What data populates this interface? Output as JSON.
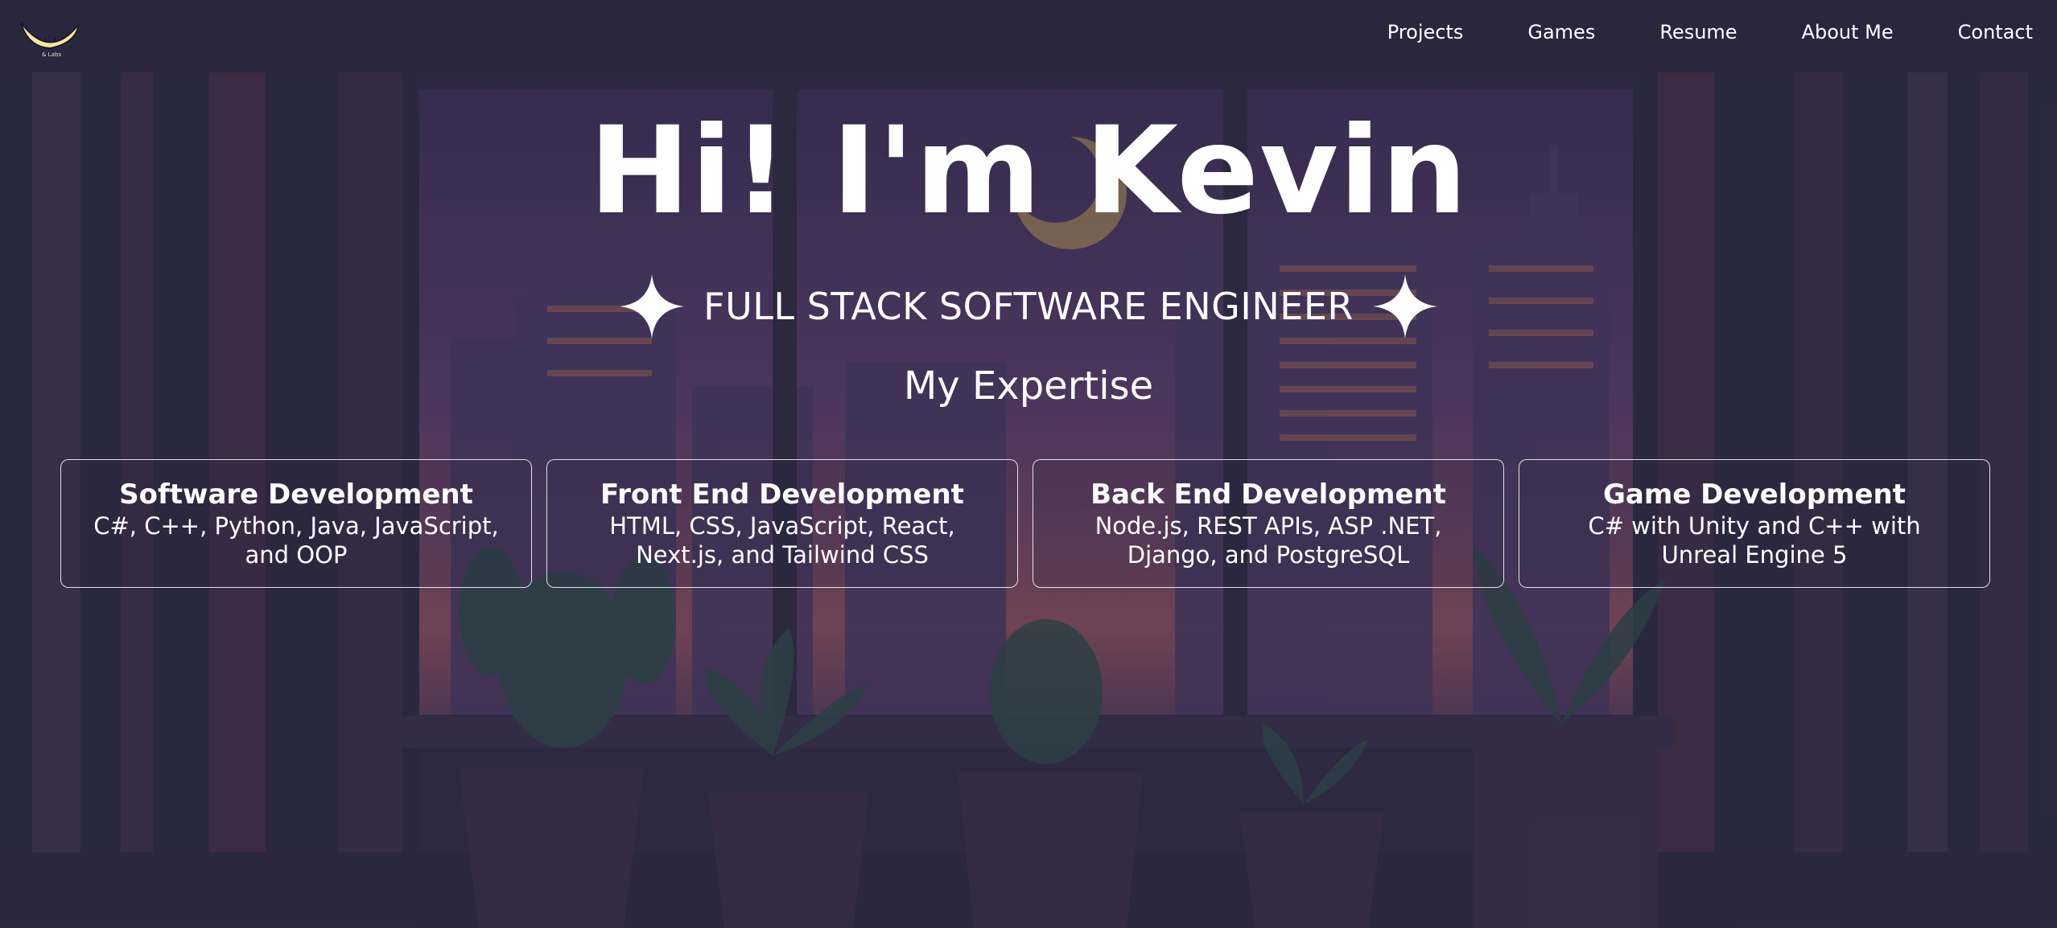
{
  "logo": {
    "text": "& Labs",
    "icon": "banana-logo-icon",
    "color": "#f6e89a"
  },
  "nav": {
    "items": [
      {
        "label": "Projects"
      },
      {
        "label": "Games"
      },
      {
        "label": "Resume"
      },
      {
        "label": "About Me"
      },
      {
        "label": "Contact"
      }
    ]
  },
  "hero": {
    "title": "Hi! I'm Kevin",
    "subtitle": "FULL STACK SOFTWARE ENGINEER",
    "sparkle_icon": "four-point-star-icon"
  },
  "expertise": {
    "heading": "My Expertise",
    "cards": [
      {
        "title": "Software Development",
        "body": "C#, C++, Python, Java, JavaScript, and OOP"
      },
      {
        "title": "Front End Development",
        "body": "HTML, CSS, JavaScript, React, Next.js, and Tailwind CSS"
      },
      {
        "title": "Back End Development",
        "body": "Node.js, REST APIs, ASP .NET, Django, and PostgreSQL"
      },
      {
        "title": "Game Development",
        "body": "C# with Unity and C++ with Unreal Engine 5"
      }
    ]
  },
  "colors": {
    "background": "#2f2b43",
    "text": "#ffffff",
    "accent_moon": "#c9a657"
  }
}
